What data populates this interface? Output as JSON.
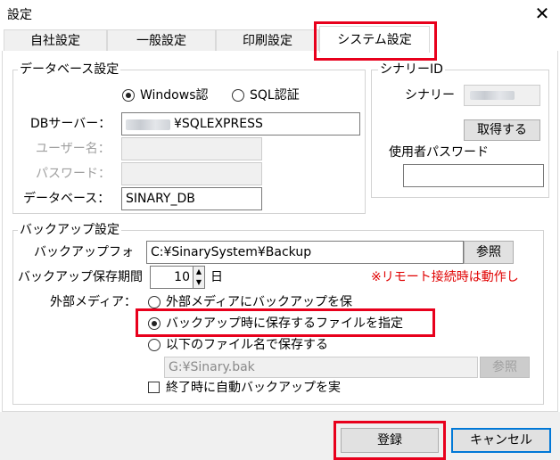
{
  "window": {
    "title": "設定",
    "close_glyph": "✕"
  },
  "tabs": [
    {
      "label": "自社設定"
    },
    {
      "label": "一般設定"
    },
    {
      "label": "印刷設定"
    },
    {
      "label": "システム設定",
      "active": true
    }
  ],
  "database": {
    "legend": "データベース設定",
    "auth_windows": "Windows認",
    "auth_sql": "SQL認証",
    "auth_selected": "Windows認",
    "server_label": "DBサーバー：",
    "server_value": "¥SQLEXPRESS",
    "user_label": "ユーザー名：",
    "password_label": "パスワード：",
    "db_label": "データベース：",
    "db_value": "SINARY_DB"
  },
  "sinary": {
    "legend": "シナリーID",
    "id_label": "シナリー",
    "acquire_button": "取得する",
    "user_password_label": "使用者パスワード"
  },
  "backup": {
    "legend": "バックアップ設定",
    "folder_label": "バックアップフォ",
    "folder_value": "C:¥SinarySystem¥Backup",
    "browse_button": "参照",
    "retention_label": "バックアップ保存期間",
    "retention_value": "10",
    "retention_unit": "日",
    "remote_note": "※リモート接続時は動作し",
    "external_media_label": "外部メディア：",
    "options": [
      {
        "label": "外部メディアにバックアップを保",
        "checked": false
      },
      {
        "label": "バックアップ時に保存するファイルを指定",
        "checked": true
      },
      {
        "label": "以下のファイル名で保存する",
        "checked": false
      }
    ],
    "file_value": "G:¥Sinary.bak",
    "file_browse_button": "参照",
    "auto_backup_label": "終了時に自動バックアップを実",
    "auto_backup_checked": false
  },
  "footer": {
    "register_button": "登録",
    "cancel_button": "キャンセル"
  },
  "colors": {
    "highlight": "#e8001c",
    "accent": "#0078d7",
    "warning_text": "#e00000"
  }
}
